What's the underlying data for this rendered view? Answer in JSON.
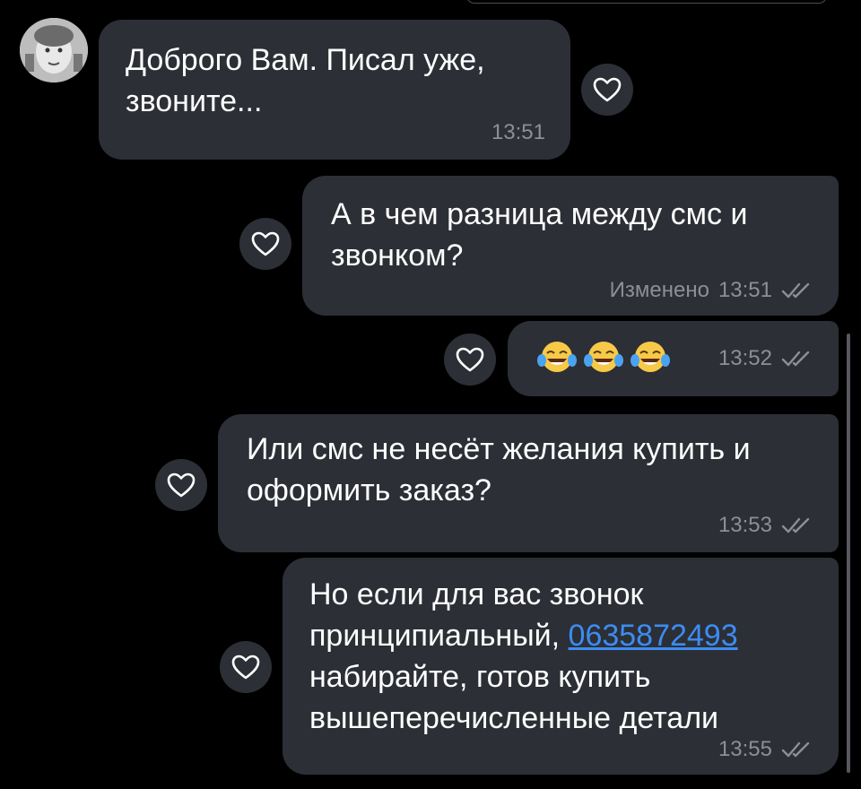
{
  "messages": [
    {
      "text": "Доброго Вам. Писал уже,\nзвоните...",
      "time": "13:51",
      "incoming": true
    },
    {
      "text": "А в чем разница между смс и\nзвонком?",
      "edited": "Изменено",
      "time": "13:51"
    },
    {
      "emoji": [
        "😂",
        "😂",
        "😂"
      ],
      "time": "13:52"
    },
    {
      "text": "Или смс не несёт желания купить и\nоформить заказ?",
      "time": "13:53"
    },
    {
      "text_before_link": "Но если для вас звонок\nпринципиальный, ",
      "link": "0635872493",
      "text_after_link": "\nнабирайте, готов купить\nвышеперечисленные детали",
      "time": "13:55"
    }
  ],
  "icons": {
    "react": "heart-outline-icon",
    "read": "double-check-icon",
    "avatar": "avatar-photo"
  },
  "colors": {
    "background": "#000000",
    "bubble": "#2c2f35",
    "meta": "#8c9096",
    "link": "#3c8cf3"
  }
}
